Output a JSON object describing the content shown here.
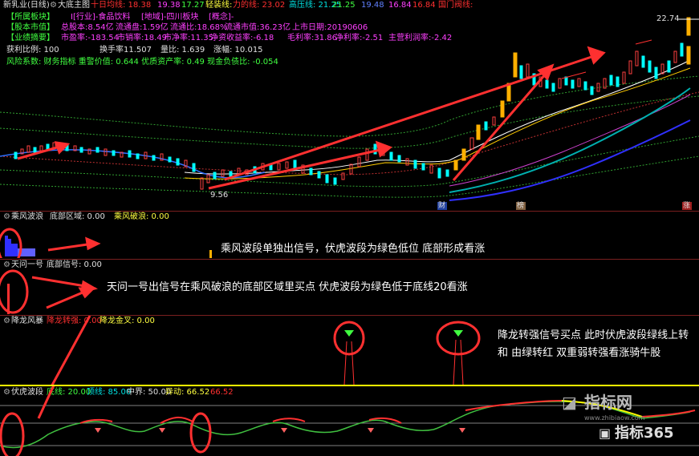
{
  "header": {
    "stock_name": "新乳业(日线)",
    "indicator_main": "大底主图",
    "ma_label1": "十日均线: 18.38",
    "ma_val1": "19.38",
    "ma_val2": "17.27",
    "ma_label2": "轻装线:",
    "lines_label": "力的线: 23.02",
    "high_label": "高压线: 21.25",
    "v1": "21.25",
    "v2": "19.48",
    "v3": "16.84",
    "v4": "16.84",
    "v5": "国门阀线:"
  },
  "info": {
    "row1_tag": "【所属板块】",
    "row1_text": "I[行业]-食品饮料",
    "row1_text2": "[地域]-四川板块",
    "row1_text3": "[概念]-",
    "row2_tag": "【股本市值】",
    "row2_a": "总股本:8.54亿",
    "row2_b": "流通盘:1.59亿",
    "row2_c": "流通比:18.68%",
    "row2_d": "流通市值:36.23亿",
    "row2_e": "上市日期:20190606",
    "row3_tag": "【业绩摘要】",
    "row3_a": "市盈率:-183.54",
    "row3_b": "市销率:18.49",
    "row3_c": "市净率:11.35",
    "row3_d": "净资收益率:-6.18",
    "row3_e": "毛利率:31.86",
    "row3_f": "净利率:-2.51",
    "row3_g": "主营利润率:-2.42",
    "risk": "风险系数: 财务指标 重警价值: 0.644 优质资产率: 0.49 现金负债比: -0.054",
    "profit_ratio": "获利比例: 100",
    "turnover": "换手率11.507",
    "volume_ratio": "量比: 1.639",
    "change": "涨幅: 10.015"
  },
  "chart_labels": {
    "high_price": "22.74",
    "low_price": "9.56",
    "marker_cai": "财",
    "marker_bang": "榜",
    "marker_zhang": "涨"
  },
  "panel2": {
    "title": "乘风波浪",
    "field1": "底部区域: 0.00",
    "field2": "乘风破浪: 0.00",
    "annotation": "乘风波段单独出信号，伏虎波段为绿色低位 底部形成看涨"
  },
  "panel3": {
    "title": "天问一号",
    "field1": "底部信号: 0.00",
    "annotation": "天问一号出信号在乘风破浪的底部区域里买点 伏虎波段为绿色低于底线20看涨"
  },
  "panel4": {
    "title": "降龙风暴",
    "field1": "降龙转强: 0.00",
    "field2": "降龙金叉: 0.00",
    "annotation": "降龙转强信号买点 此时伏虎波段绿线上转 和 由绿转红 双重弱转强看涨骑牛股"
  },
  "panel5": {
    "title": "伏虎波段",
    "field1": "底线: 20.00",
    "field2": "顶线: 85.00",
    "field3": "中界: 50.00",
    "field4": "异动: 66.52",
    "field5": "66.52"
  },
  "watermark": {
    "logo1": "指标网",
    "logo1_sub": "www.zhibiaow.com",
    "logo2": "指标365"
  }
}
